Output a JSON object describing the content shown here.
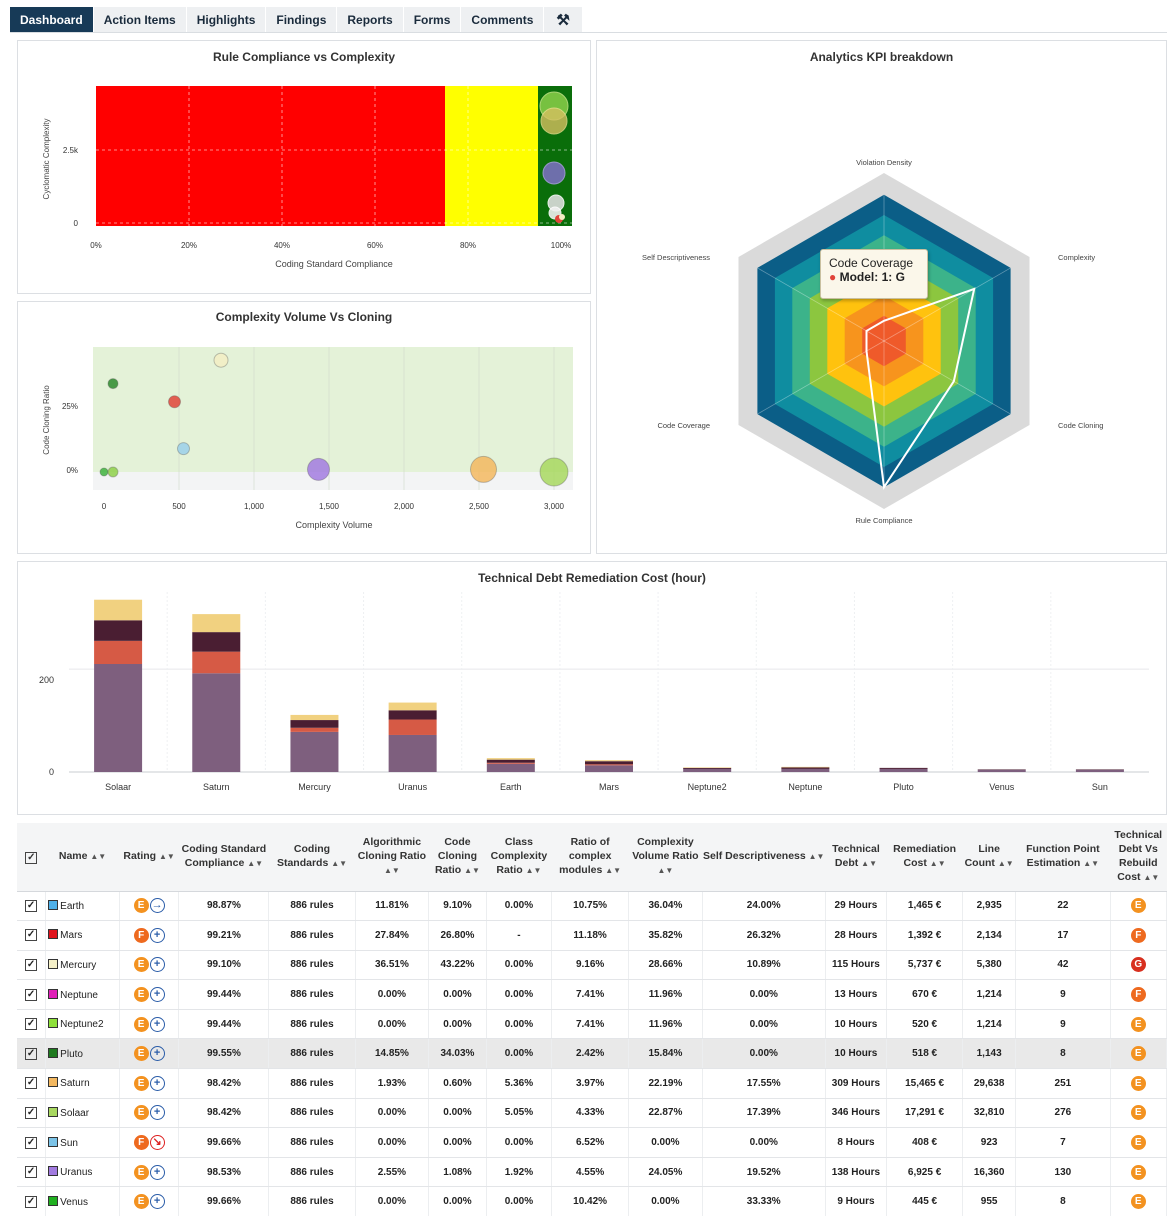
{
  "tabs": [
    "Dashboard",
    "Action Items",
    "Highlights",
    "Findings",
    "Reports",
    "Forms",
    "Comments"
  ],
  "tool_icon": "wrench-icon",
  "rule_chart": {
    "title": "Rule Compliance vs Complexity",
    "xlabel": "Coding Standard Compliance",
    "ylabel": "Cyclomatic Complexity",
    "xticks": [
      "0%",
      "20%",
      "40%",
      "60%",
      "80%",
      "100%"
    ],
    "yticks": [
      "0",
      "2.5k"
    ]
  },
  "cloning_chart": {
    "title": "Complexity Volume Vs Cloning",
    "xlabel": "Complexity Volume",
    "ylabel": "Code Cloning Ratio",
    "xticks": [
      "0",
      "500",
      "1,000",
      "1,500",
      "2,000",
      "2,500",
      "3,000"
    ],
    "yticks": [
      "0%",
      "25%"
    ]
  },
  "radar": {
    "title": "Analytics KPI breakdown",
    "axes": [
      "Violation Density",
      "Complexity",
      "Code Cloning",
      "Rule Compliance",
      "Code Coverage",
      "Self Descriptiveness"
    ],
    "tooltip_title": "Code Coverage",
    "tooltip_value": "Model: 1: G"
  },
  "debt_chart": {
    "title": "Technical Debt Remediation Cost (hour)",
    "yticks": [
      "0",
      "200"
    ]
  },
  "chart_data": [
    {
      "type": "bar",
      "title": "Technical Debt Remediation Cost (hour)",
      "categories": [
        "Solaar",
        "Saturn",
        "Mercury",
        "Uranus",
        "Earth",
        "Mars",
        "Neptune2",
        "Neptune",
        "Pluto",
        "Venus",
        "Sun"
      ],
      "series": [
        {
          "color": "#7e5f7e",
          "values": [
            210,
            192,
            78,
            72,
            16,
            13,
            6,
            6,
            6,
            4,
            4
          ]
        },
        {
          "color": "#d65a45",
          "values": [
            45,
            42,
            8,
            30,
            2,
            2,
            0,
            0,
            0,
            0,
            0
          ]
        },
        {
          "color": "#4a1e32",
          "values": [
            40,
            38,
            15,
            18,
            6,
            6,
            2,
            3,
            2,
            1,
            1
          ]
        },
        {
          "color": "#f1d180",
          "values": [
            40,
            35,
            10,
            15,
            3,
            2,
            1,
            1,
            0,
            0,
            0
          ]
        }
      ],
      "ylim": [
        0,
        350
      ]
    },
    {
      "type": "scatter",
      "title": "Complexity Volume Vs Cloning",
      "xlabel": "Complexity Volume",
      "ylabel": "Code Cloning Ratio",
      "points": [
        {
          "x": 60,
          "y": 34,
          "color": "#2e8b2e"
        },
        {
          "x": 470,
          "y": 27,
          "color": "#e0443a"
        },
        {
          "x": 530,
          "y": 9,
          "color": "#9bd0ea"
        },
        {
          "x": 780,
          "y": 43,
          "color": "#f3eec4"
        },
        {
          "x": 0,
          "y": 0,
          "color": "#3fb33f"
        },
        {
          "x": 60,
          "y": 0,
          "color": "#8ed04a"
        },
        {
          "x": 1430,
          "y": 1,
          "color": "#a27be0"
        },
        {
          "x": 2530,
          "y": 1,
          "color": "#f3b860"
        },
        {
          "x": 3000,
          "y": 0,
          "color": "#a8d860"
        }
      ],
      "xlim": [
        -70,
        3130
      ],
      "ylim": [
        -10,
        45
      ]
    }
  ],
  "table": {
    "headers": [
      "Name",
      "Rating",
      "Coding Standard Compliance",
      "Coding Standards",
      "Algorithmic Cloning Ratio",
      "Code Cloning Ratio",
      "Class Complexity Ratio",
      "Ratio of complex modules",
      "Complexity Volume Ratio",
      "Self Descriptiveness",
      "Technical Debt",
      "Remediation Cost",
      "Line Count",
      "Function Point Estimation",
      "Technical Debt Vs Rebuild Cost"
    ],
    "rows": [
      {
        "name": "Earth",
        "color": "#4fb0e8",
        "rating": "E",
        "rcol": "#f39220",
        "trend": "→",
        "down": false,
        "c": [
          "98.87%",
          "886 rules",
          "11.81%",
          "9.10%",
          "0.00%",
          "10.75%",
          "36.04%",
          "24.00%",
          "29 Hours",
          "1,465 €",
          "2,935",
          "22"
        ],
        "final": "E",
        "fcol": "#f39220"
      },
      {
        "name": "Mars",
        "color": "#e0141e",
        "rating": "F",
        "rcol": "#ee6a1f",
        "trend": "+",
        "down": false,
        "c": [
          "99.21%",
          "886 rules",
          "27.84%",
          "26.80%",
          "-",
          "11.18%",
          "35.82%",
          "26.32%",
          "28 Hours",
          "1,392 €",
          "2,134",
          "17"
        ],
        "final": "F",
        "fcol": "#ee6a1f"
      },
      {
        "name": "Mercury",
        "color": "#f5f0c8",
        "rating": "E",
        "rcol": "#f39220",
        "trend": "+",
        "down": false,
        "c": [
          "99.10%",
          "886 rules",
          "36.51%",
          "43.22%",
          "0.00%",
          "9.16%",
          "28.66%",
          "10.89%",
          "115 Hours",
          "5,737 €",
          "5,380",
          "42"
        ],
        "final": "G",
        "fcol": "#d8301f"
      },
      {
        "name": "Neptune",
        "color": "#e020b8",
        "rating": "E",
        "rcol": "#f39220",
        "trend": "+",
        "down": false,
        "c": [
          "99.44%",
          "886 rules",
          "0.00%",
          "0.00%",
          "0.00%",
          "7.41%",
          "11.96%",
          "0.00%",
          "13 Hours",
          "670 €",
          "1,214",
          "9"
        ],
        "final": "F",
        "fcol": "#ee6a1f"
      },
      {
        "name": "Neptune2",
        "color": "#8ee03a",
        "rating": "E",
        "rcol": "#f39220",
        "trend": "+",
        "down": false,
        "c": [
          "99.44%",
          "886 rules",
          "0.00%",
          "0.00%",
          "0.00%",
          "7.41%",
          "11.96%",
          "0.00%",
          "10 Hours",
          "520 €",
          "1,214",
          "9"
        ],
        "final": "E",
        "fcol": "#f39220"
      },
      {
        "name": "Pluto",
        "color": "#1f7a1f",
        "rating": "E",
        "rcol": "#f39220",
        "trend": "+",
        "down": false,
        "hl": true,
        "c": [
          "99.55%",
          "886 rules",
          "14.85%",
          "34.03%",
          "0.00%",
          "2.42%",
          "15.84%",
          "0.00%",
          "10 Hours",
          "518 €",
          "1,143",
          "8"
        ],
        "final": "E",
        "fcol": "#f39220"
      },
      {
        "name": "Saturn",
        "color": "#f3b860",
        "rating": "E",
        "rcol": "#f39220",
        "trend": "+",
        "down": false,
        "c": [
          "98.42%",
          "886 rules",
          "1.93%",
          "0.60%",
          "5.36%",
          "3.97%",
          "22.19%",
          "17.55%",
          "309 Hours",
          "15,465 €",
          "29,638",
          "251"
        ],
        "final": "E",
        "fcol": "#f39220"
      },
      {
        "name": "Solaar",
        "color": "#a8d860",
        "rating": "E",
        "rcol": "#f39220",
        "trend": "+",
        "down": false,
        "c": [
          "98.42%",
          "886 rules",
          "0.00%",
          "0.00%",
          "5.05%",
          "4.33%",
          "22.87%",
          "17.39%",
          "346 Hours",
          "17,291 €",
          "32,810",
          "276"
        ],
        "final": "E",
        "fcol": "#f39220"
      },
      {
        "name": "Sun",
        "color": "#7cc4e8",
        "rating": "F",
        "rcol": "#ee6a1f",
        "trend": "↘",
        "down": true,
        "c": [
          "99.66%",
          "886 rules",
          "0.00%",
          "0.00%",
          "0.00%",
          "6.52%",
          "0.00%",
          "0.00%",
          "8 Hours",
          "408 €",
          "923",
          "7"
        ],
        "final": "E",
        "fcol": "#f39220"
      },
      {
        "name": "Uranus",
        "color": "#a27be0",
        "rating": "E",
        "rcol": "#f39220",
        "trend": "+",
        "down": false,
        "c": [
          "98.53%",
          "886 rules",
          "2.55%",
          "1.08%",
          "1.92%",
          "4.55%",
          "24.05%",
          "19.52%",
          "138 Hours",
          "6,925 €",
          "16,360",
          "130"
        ],
        "final": "E",
        "fcol": "#f39220"
      },
      {
        "name": "Venus",
        "color": "#20b020",
        "rating": "E",
        "rcol": "#f39220",
        "trend": "+",
        "down": false,
        "c": [
          "99.66%",
          "886 rules",
          "0.00%",
          "0.00%",
          "0.00%",
          "10.42%",
          "0.00%",
          "33.33%",
          "9 Hours",
          "445 €",
          "955",
          "8"
        ],
        "final": "E",
        "fcol": "#f39220"
      }
    ]
  }
}
